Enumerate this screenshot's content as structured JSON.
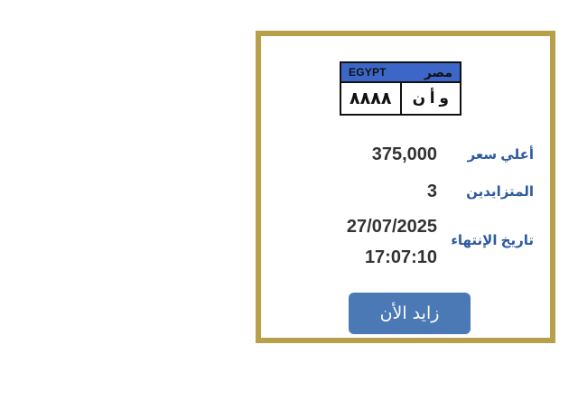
{
  "plate": {
    "country_en": "EGYPT",
    "country_ar": "مصر",
    "numbers": "٨٨٨٨",
    "letters": "و أ ن"
  },
  "details": {
    "highest_bid_label": "أعلي سعر",
    "highest_bid_value": "375,000",
    "bidders_label": "المتزايدين",
    "bidders_value": "3",
    "end_date_label": "تاريخ الإنتهاء",
    "end_date_value": "27/07/2025",
    "end_time_value": "17:07:10"
  },
  "actions": {
    "bid_now_label": "زايد الأن"
  },
  "colors": {
    "card_border": "#b8a04a",
    "plate_header": "#3c67c9",
    "label_text": "#2c5aa0",
    "button_bg": "#4a79b6"
  }
}
